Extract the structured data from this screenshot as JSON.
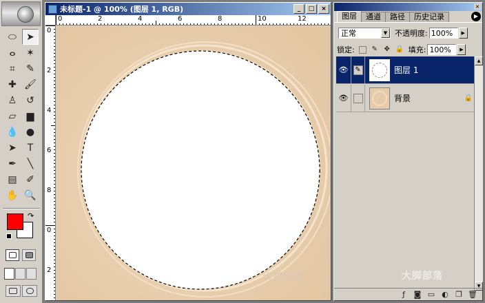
{
  "document": {
    "title": "未标题-1 @ 100% (图层 1, RGB)",
    "buttons": {
      "minimize": "_",
      "maximize": "□",
      "close": "×"
    },
    "ruler_top": [
      "0",
      "2",
      "4",
      "6",
      "8",
      "10",
      "12"
    ],
    "ruler_left": [
      "0",
      "2",
      "4",
      "6",
      "8",
      "0",
      "2"
    ]
  },
  "toolbox": {
    "tools": [
      {
        "name": "marquee-tool",
        "glyph": "⬭"
      },
      {
        "name": "move-tool",
        "glyph": "➤"
      },
      {
        "name": "lasso-tool",
        "glyph": "ⴰ"
      },
      {
        "name": "magic-wand-tool",
        "glyph": "✶"
      },
      {
        "name": "crop-tool",
        "glyph": "⌗"
      },
      {
        "name": "slice-tool",
        "glyph": "✎"
      },
      {
        "name": "healing-brush-tool",
        "glyph": "✚"
      },
      {
        "name": "brush-tool",
        "glyph": "🖌"
      },
      {
        "name": "clone-stamp-tool",
        "glyph": "♙"
      },
      {
        "name": "history-brush-tool",
        "glyph": "↺"
      },
      {
        "name": "eraser-tool",
        "glyph": "▱"
      },
      {
        "name": "gradient-tool",
        "glyph": "▆"
      },
      {
        "name": "blur-tool",
        "glyph": "💧"
      },
      {
        "name": "dodge-tool",
        "glyph": "●"
      },
      {
        "name": "path-selection-tool",
        "glyph": "➤"
      },
      {
        "name": "type-tool",
        "glyph": "T"
      },
      {
        "name": "pen-tool",
        "glyph": "✒"
      },
      {
        "name": "line-tool",
        "glyph": "╲"
      },
      {
        "name": "notes-tool",
        "glyph": "▤"
      },
      {
        "name": "eyedropper-tool",
        "glyph": "✐"
      },
      {
        "name": "hand-tool",
        "glyph": "✋"
      },
      {
        "name": "zoom-tool",
        "glyph": "🔍"
      }
    ],
    "colors": {
      "foreground": "#ff0000",
      "background": "#ffffff"
    }
  },
  "layers_panel": {
    "tabs": [
      "图层",
      "通道",
      "路径",
      "历史记录"
    ],
    "blend_mode": "正常",
    "opacity_label": "不透明度:",
    "opacity_value": "100%",
    "lock_label": "锁定:",
    "fill_label": "填充:",
    "fill_value": "100%",
    "layers": [
      {
        "name": "图层 1",
        "selected": true,
        "visible": true
      },
      {
        "name": "背景",
        "selected": false,
        "visible": true,
        "locked": true
      }
    ],
    "watermark": "大脚部落"
  },
  "canvas": {
    "watermark": "大脚部落",
    "background_color": "#e8cfb0"
  }
}
